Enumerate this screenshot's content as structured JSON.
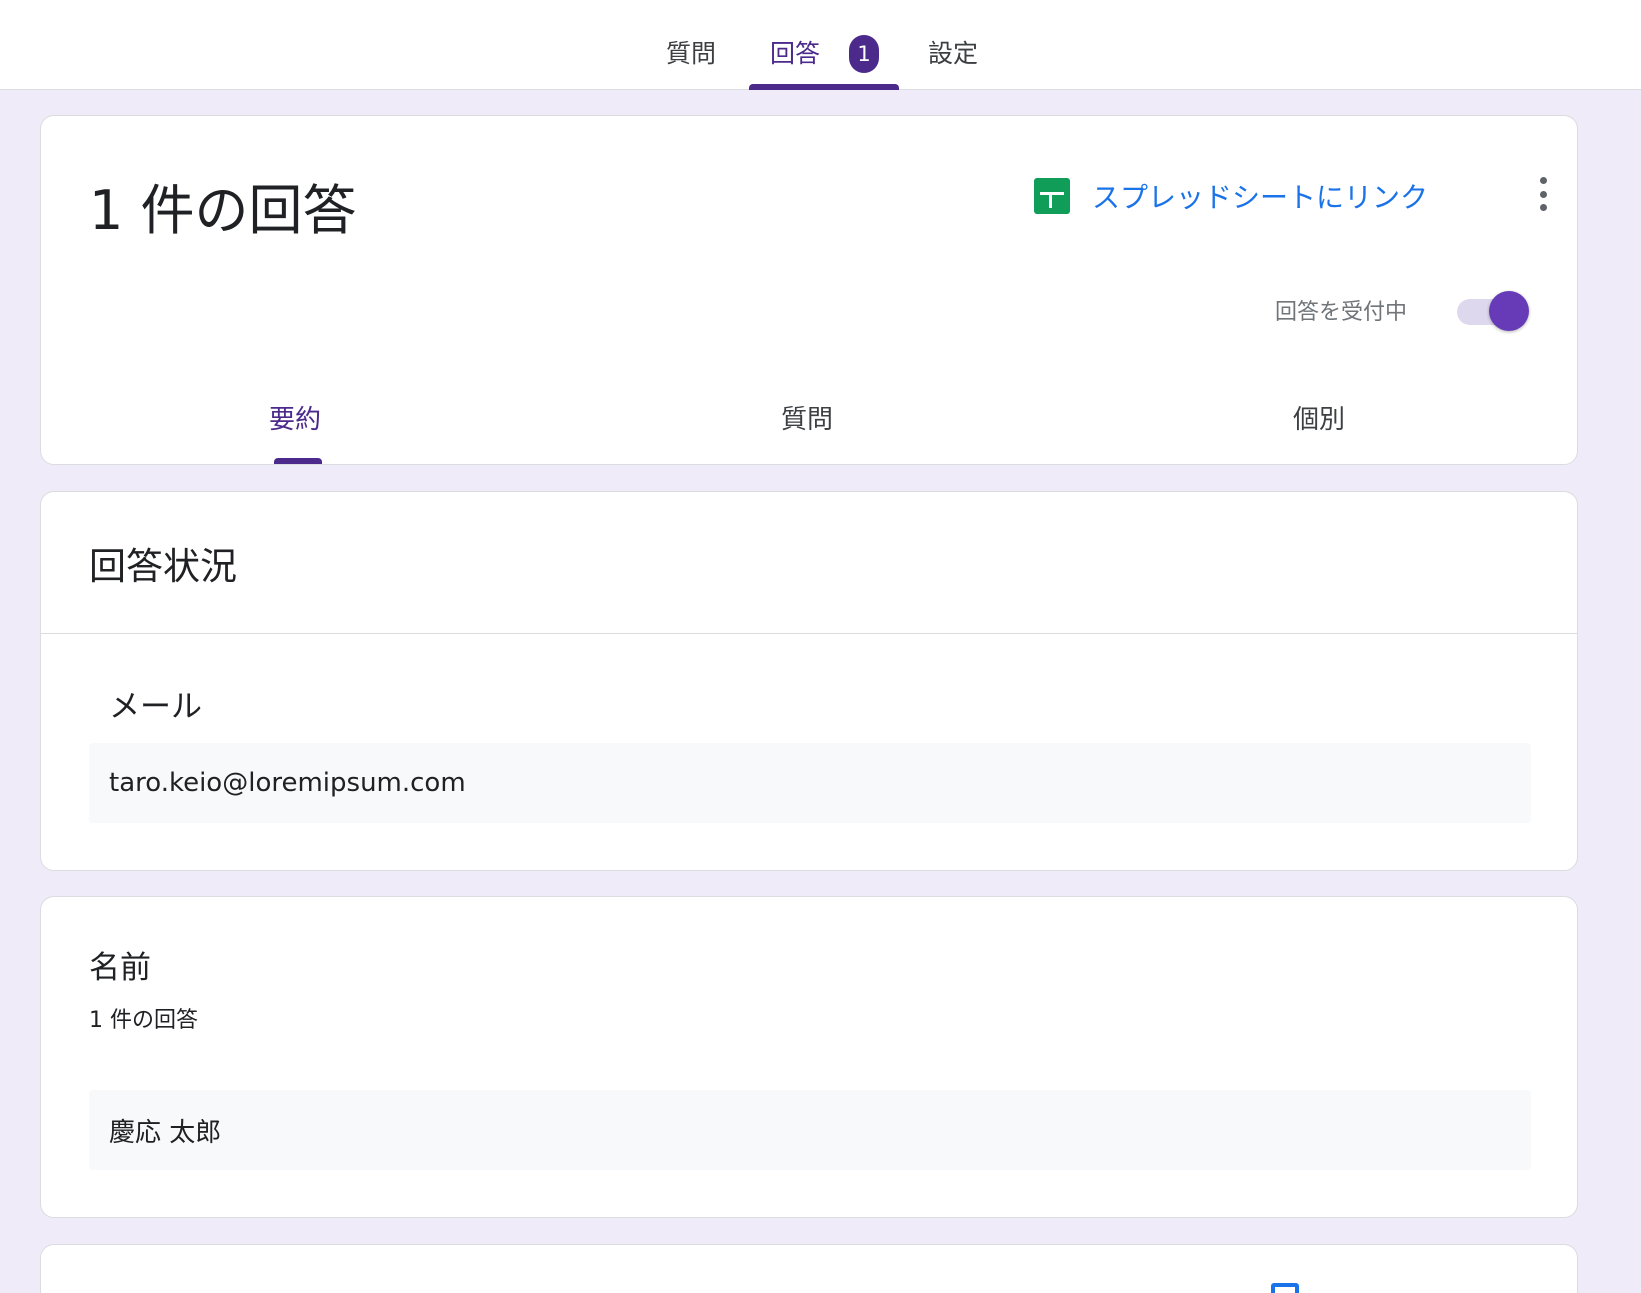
{
  "top_tabs": {
    "questions": "質問",
    "responses": "回答",
    "response_count_badge": "1",
    "settings": "設定",
    "active": "responses"
  },
  "header": {
    "title": "1 件の回答",
    "spreadsheet_link": "スプレッドシートにリンク",
    "accepting_label": "回答を受付中",
    "accepting_on": true,
    "subtabs": [
      "要約",
      "質問",
      "個別"
    ],
    "active_subtab": "要約"
  },
  "status_section": {
    "title": "回答状況",
    "email_label": "メール",
    "email_value": "taro.keio@loremipsum.com"
  },
  "name_question": {
    "title": "名前",
    "count": "1 件の回答",
    "answer": "慶応 太郎"
  },
  "colors": {
    "accent": "#4b2a8c",
    "toggle": "#673ab7",
    "link": "#1a73e8",
    "sheets": "#0f9d58",
    "background": "#f0ebf8"
  }
}
